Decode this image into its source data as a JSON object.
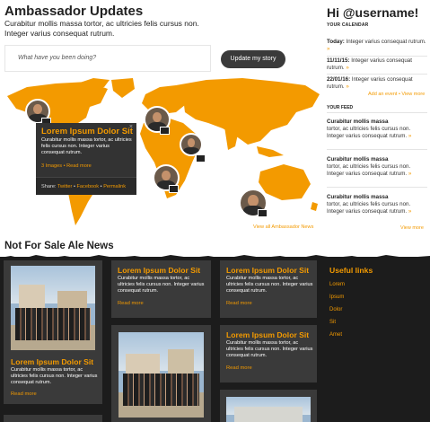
{
  "ambassador": {
    "title": "Ambassador Updates",
    "subtitle": "Curabitur mollis massa tortor, ac ultricies felis cursus non. Integer varius consequat rutrum.",
    "status_placeholder": "What have you been doing?",
    "update_button": "Update my story"
  },
  "map": {
    "popup": {
      "close": "×",
      "title": "Lorem Ipsum Dolor Sit",
      "text": "Curabitur mollis massa tortor, ac ultricies felis cursus non. Integer varius consequat rutrum.",
      "images_link": "3 Images",
      "separator": "•",
      "read_more": "Read more",
      "share_label": "Share:",
      "share_links": [
        "Twitter",
        "Facebook",
        "Permalink"
      ]
    },
    "view_all": "View all Ambassador News",
    "colors": {
      "land": "#f39a00",
      "accent": "#f39a00"
    }
  },
  "sidebar": {
    "greeting": "Hi @username!",
    "calendar_label": "YOUR CALENDAR",
    "calendar": [
      {
        "date": "Today:",
        "text": "Integer varius consequat rutrum."
      },
      {
        "date": "11/11/15:",
        "text": "Integer varius consequat rutrum."
      },
      {
        "date": "22/01/16:",
        "text": "Integer varius consequat rutrum."
      }
    ],
    "add_event": "Add an event",
    "view_more_cal": "View more",
    "feed_label": "YOUR FEED",
    "feed": [
      {
        "title": "Curabitur mollis massa",
        "text": "tortor, ac ultricies felis cursus non. Integer varius consequat rutrum."
      },
      {
        "title": "Curabitur mollis massa",
        "text": "tortor, ac ultricies felis cursus non. Integer varius consequat rutrum."
      },
      {
        "title": "Curabitur mollis massa",
        "text": "tortor, ac ultricies felis cursus non. Integer varius consequat rutrum."
      }
    ],
    "view_more": "View more",
    "arrow_glyph": "»"
  },
  "news": {
    "title": "Not For Sale Ale News",
    "card_title": "Lorem Ipsum Dolor Sit",
    "card_text": "Curabitur mollis massa tortor, ac ultricies felis cursus non. Integer varius consequat rutrum.",
    "read_more": "Read more",
    "useful_title": "Useful links",
    "useful_links": [
      "Lorem",
      "Ipsum",
      "Dolor",
      "Sit",
      "Amet"
    ]
  }
}
